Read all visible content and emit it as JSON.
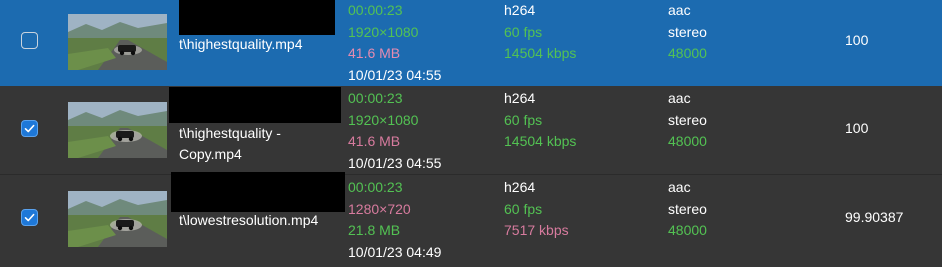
{
  "colors": {
    "row_selected_bg": "#1c6bb0",
    "row_bg": "#363636",
    "value_good": "#53c253",
    "value_bad": "#d77b9e",
    "checkbox_checked": "#1e78d8"
  },
  "rows": [
    {
      "selected": true,
      "checked": false,
      "thumbnail_icon": "video-thumbnail",
      "filename": "t\\highestquality.mp4",
      "duration": "00:00:23",
      "resolution": "1920×1080",
      "size": "41.6 MB",
      "date": "10/01/23 04:55",
      "codec": "h264",
      "fps": "60 fps",
      "bitrate": "14504 kbps",
      "audio_codec": "aac",
      "channels": "stereo",
      "sample_rate": "48000",
      "score": "100"
    },
    {
      "selected": false,
      "checked": true,
      "thumbnail_icon": "video-thumbnail",
      "filename": "t\\highestquality - Copy.mp4",
      "duration": "00:00:23",
      "resolution": "1920×1080",
      "size": "41.6 MB",
      "date": "10/01/23 04:55",
      "codec": "h264",
      "fps": "60 fps",
      "bitrate": "14504 kbps",
      "audio_codec": "aac",
      "channels": "stereo",
      "sample_rate": "48000",
      "score": "100"
    },
    {
      "selected": false,
      "checked": true,
      "thumbnail_icon": "video-thumbnail",
      "filename": "t\\lowestresolution.mp4",
      "duration": "00:00:23",
      "resolution": "1280×720",
      "size": "21.8 MB",
      "date": "10/01/23 04:49",
      "codec": "h264",
      "fps": "60 fps",
      "bitrate": "7517 kbps",
      "audio_codec": "aac",
      "channels": "stereo",
      "sample_rate": "48000",
      "score": "99.90387"
    }
  ]
}
